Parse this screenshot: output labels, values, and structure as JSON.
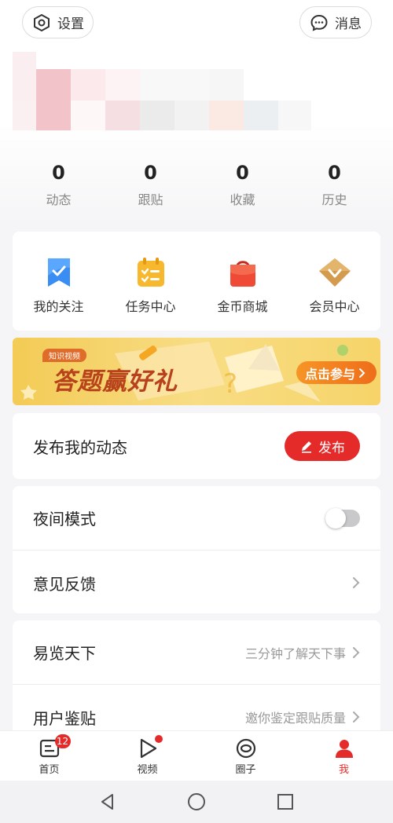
{
  "header": {
    "settings_label": "设置",
    "messages_label": "消息"
  },
  "stats": [
    {
      "value": "0",
      "label": "动态"
    },
    {
      "value": "0",
      "label": "跟贴"
    },
    {
      "value": "0",
      "label": "收藏"
    },
    {
      "value": "0",
      "label": "历史"
    }
  ],
  "shortcuts": [
    {
      "label": "我的关注",
      "icon": "bookmark-icon"
    },
    {
      "label": "任务中心",
      "icon": "task-list-icon"
    },
    {
      "label": "金币商城",
      "icon": "shopping-bag-icon"
    },
    {
      "label": "会员中心",
      "icon": "diamond-icon"
    }
  ],
  "banner": {
    "tag": "知识视频",
    "title": "答题赢好礼",
    "cta": "点击参与"
  },
  "publish": {
    "title": "发布我的动态",
    "button_label": "发布"
  },
  "settings": {
    "night_mode_label": "夜间模式",
    "night_mode_on": false,
    "feedback_label": "意见反馈"
  },
  "list": [
    {
      "title": "易览天下",
      "subtitle": "三分钟了解天下事"
    },
    {
      "title": "用户鉴贴",
      "subtitle": "邀你鉴定跟贴质量"
    }
  ],
  "tabs": [
    {
      "label": "首页",
      "icon": "news-icon",
      "badge": "12"
    },
    {
      "label": "视频",
      "icon": "play-icon",
      "dot": true
    },
    {
      "label": "圈子",
      "icon": "circle-eye-icon"
    },
    {
      "label": "我",
      "icon": "person-icon",
      "active": true
    }
  ],
  "colors": {
    "accent": "#e52a2a",
    "banner": "#f3cb55",
    "background": "#f5f5f7"
  }
}
